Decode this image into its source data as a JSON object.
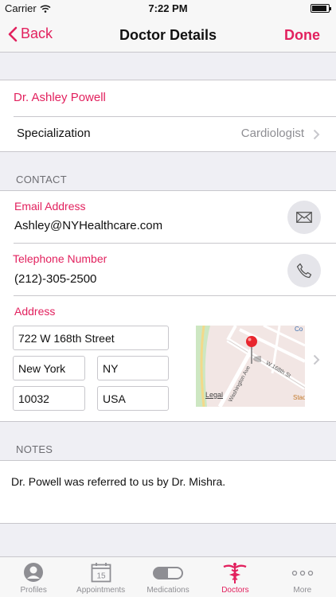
{
  "status_bar": {
    "carrier": "Carrier",
    "time": "7:22 PM",
    "battery_level": 0.9
  },
  "nav": {
    "back_label": "Back",
    "title": "Doctor Details",
    "done_label": "Done"
  },
  "doctor": {
    "name": "Dr. Ashley Powell",
    "specialization_label": "Specialization",
    "specialization_value": "Cardiologist"
  },
  "contact": {
    "header": "CONTACT",
    "email_label": "Email Address",
    "email_value": "Ashley@NYHealthcare.com",
    "email_icon": "envelope-icon",
    "phone_label": "Telephone Number",
    "phone_value": "(212)-305-2500",
    "phone_icon": "phone-icon",
    "address_label": "Address",
    "street": "722 W 168th Street",
    "city": "New York",
    "state": "NY",
    "zip": "10032",
    "country": "USA",
    "map": {
      "legal": "Legal",
      "street_label_1": "W 168th St",
      "street_label_2": "Washington Ave",
      "poi_label": "Stad",
      "poi_label_top": "Co"
    }
  },
  "notes": {
    "header": "NOTES",
    "text": "Dr. Powell was referred to us by Dr. Mishra."
  },
  "tabs": [
    {
      "label": "Profiles",
      "icon": "person-icon"
    },
    {
      "label": "Appointments",
      "icon": "calendar-icon",
      "day": "15"
    },
    {
      "label": "Medications",
      "icon": "pill-icon"
    },
    {
      "label": "Doctors",
      "icon": "caduceus-icon",
      "active": true
    },
    {
      "label": "More",
      "icon": "more-icon"
    }
  ],
  "colors": {
    "accent": "#e2215e",
    "background": "#efeff4",
    "secondary_text": "#8e8e93"
  }
}
